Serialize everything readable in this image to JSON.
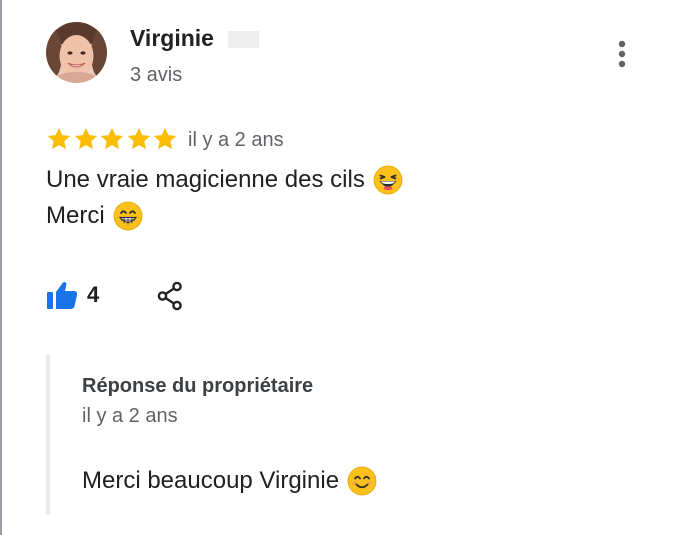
{
  "review": {
    "reviewer": {
      "name": "Virginie",
      "review_count": "3 avis"
    },
    "rating": 5,
    "date": "il y a 2 ans",
    "text_lines": [
      "Une vraie magicienne des cils",
      "Merci"
    ],
    "likes": "4"
  },
  "owner_reply": {
    "title": "Réponse du propriétaire",
    "date": "il y a 2 ans",
    "text": "Merci beaucoup Virginie"
  },
  "icons": {
    "avatar": "avatar",
    "more": "more-vert-icon",
    "star": "star-icon",
    "like": "thumb-up-icon",
    "share": "share-icon",
    "emoji_line1": "grinning-squinting-face-emoji",
    "emoji_line2": "beaming-face-emoji",
    "emoji_reply": "smiling-face-emoji"
  },
  "colors": {
    "star": "#fbbc04",
    "like": "#1a73e8",
    "secondary_text": "#5f6368",
    "reply_border": "#e8eaed"
  }
}
